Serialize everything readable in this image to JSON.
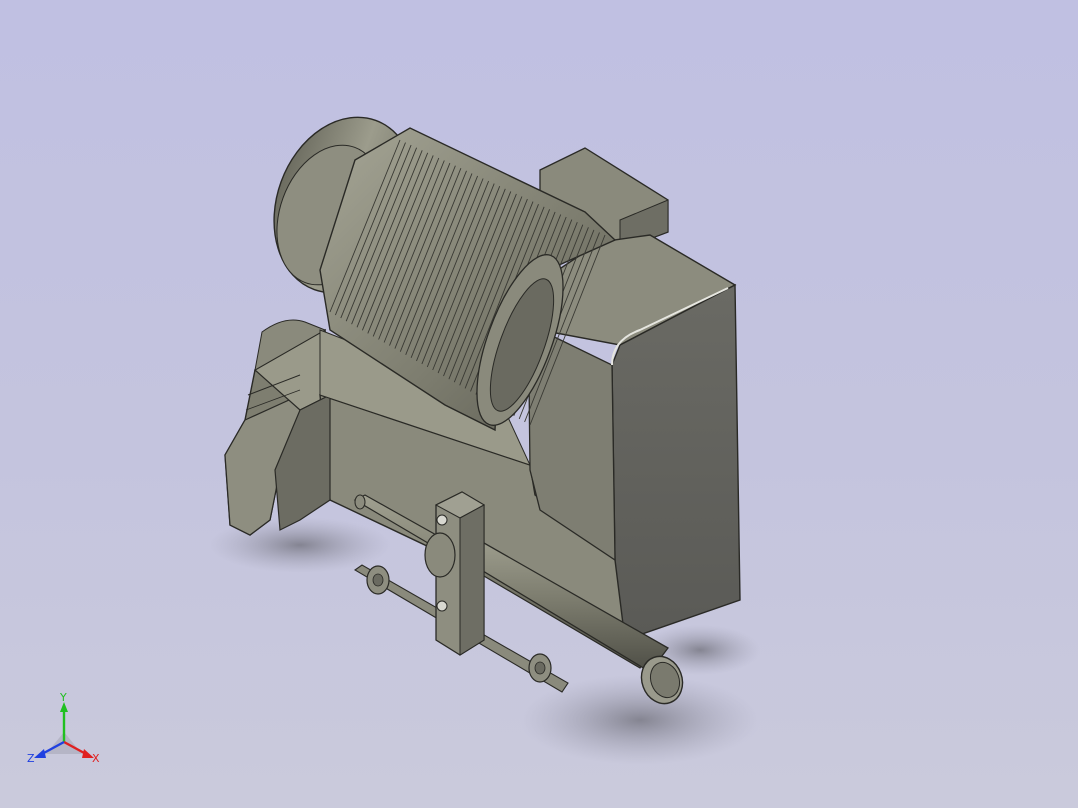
{
  "viewport": {
    "background_top": "#c0c0e2",
    "background_bottom": "#cacadc"
  },
  "model": {
    "body_color": "#8a8a7a",
    "shadow_color": "#6a6a60",
    "dark_face_color": "#5e5e58"
  },
  "triad": {
    "x_label": "X",
    "y_label": "Y",
    "z_label": "Z",
    "x_color": "#e02020",
    "y_color": "#20c020",
    "z_color": "#2040e0"
  }
}
